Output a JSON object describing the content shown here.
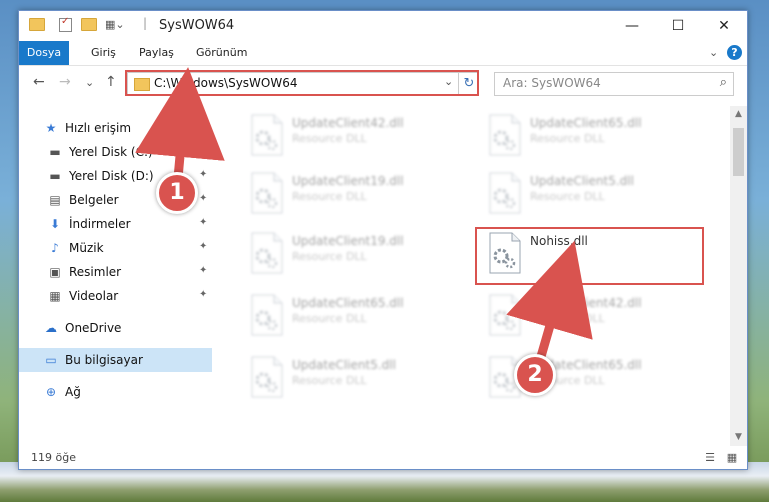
{
  "window": {
    "title": "SysWOW64",
    "min_symbol": "—",
    "max_symbol": "☐",
    "close_symbol": "✕"
  },
  "ribbon": {
    "tabs": [
      "Dosya",
      "Giriş",
      "Paylaş",
      "Görünüm"
    ],
    "expand_symbol": "⌄",
    "help_symbol": "?"
  },
  "navigation": {
    "back_symbol": "←",
    "forward_symbol": "→",
    "recent_symbol": "⌄",
    "up_symbol": "↑"
  },
  "address": {
    "path": "C:\\Windows\\SysWOW64",
    "dropdown_symbol": "⌄",
    "refresh_symbol": "↻"
  },
  "search": {
    "placeholder": "Ara: SysWOW64",
    "icon_symbol": "⌕"
  },
  "sidebar": {
    "items": [
      {
        "label": "Hızlı erişim",
        "icon": "star-icon",
        "glyph": "★",
        "pinned": false
      },
      {
        "label": "Yerel Disk (C:)",
        "icon": "drive-icon",
        "glyph": "▬",
        "pinned": true
      },
      {
        "label": "Yerel Disk (D:)",
        "icon": "drive-icon",
        "glyph": "▬",
        "pinned": true
      },
      {
        "label": "Belgeler",
        "icon": "document-icon",
        "glyph": "▤",
        "pinned": true
      },
      {
        "label": "İndirmeler",
        "icon": "download-icon",
        "glyph": "⬇",
        "pinned": true
      },
      {
        "label": "Müzik",
        "icon": "music-icon",
        "glyph": "♪",
        "pinned": true
      },
      {
        "label": "Resimler",
        "icon": "picture-icon",
        "glyph": "▣",
        "pinned": true
      },
      {
        "label": "Videolar",
        "icon": "video-icon",
        "glyph": "▦",
        "pinned": true
      },
      {
        "label": "OneDrive",
        "icon": "cloud-icon",
        "glyph": "☁",
        "pinned": false
      },
      {
        "label": "Bu bilgisayar",
        "icon": "computer-icon",
        "glyph": "▭",
        "pinned": false,
        "selected": true
      },
      {
        "label": "Ağ",
        "icon": "network-icon",
        "glyph": "⊕",
        "pinned": false
      }
    ],
    "pin_glyph": "📌"
  },
  "files": [
    {
      "name": "UpdateClient42.dll",
      "type": "Resource DLL",
      "blur": true
    },
    {
      "name": "UpdateClient65.dll",
      "type": "Resource DLL",
      "blur": true
    },
    {
      "name": "UpdateClient19.dll",
      "type": "Resource DLL",
      "blur": true
    },
    {
      "name": "UpdateClient5.dll",
      "type": "Resource DLL",
      "blur": true
    },
    {
      "name": "UpdateClient19.dll",
      "type": "Resource DLL",
      "blur": true
    },
    {
      "name": "Nohiss.dll",
      "type": "",
      "blur": false
    },
    {
      "name": "UpdateClient65.dll",
      "type": "Resource DLL",
      "blur": true
    },
    {
      "name": "UpdateClient42.dll",
      "type": "Resource DLL",
      "blur": true
    },
    {
      "name": "UpdateClient5.dll",
      "type": "Resource DLL",
      "blur": true
    },
    {
      "name": "UpdateClient65.dll",
      "type": "Resource DLL",
      "blur": true
    }
  ],
  "status": {
    "item_count": "119 öğe"
  },
  "callouts": [
    "1",
    "2"
  ],
  "colors": {
    "accent": "#1979ca",
    "highlight_red": "#d9534f",
    "selected_bg": "#cce4f7"
  }
}
